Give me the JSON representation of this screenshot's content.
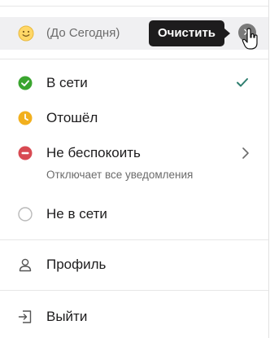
{
  "status": {
    "text": "(До Сегодня)",
    "clear_tooltip": "Очистить"
  },
  "presence": {
    "items": [
      {
        "label": "В сети",
        "state": "online",
        "color": "#3aa52f",
        "selected": true
      },
      {
        "label": "Отошёл",
        "state": "away",
        "color": "#f2b01e"
      },
      {
        "label": "Не беспокоить",
        "state": "dnd",
        "color": "#d84a52",
        "sub": "Отключает все уведомления"
      },
      {
        "label": "Не в сети",
        "state": "offline",
        "color": "#ffffff"
      }
    ]
  },
  "menu": {
    "profile": "Профиль",
    "logout": "Выйти"
  },
  "colors": {
    "accent_check": "#2d7d6e"
  },
  "icons": [
    "smiley-emoji-icon",
    "clear-x-icon",
    "checkmark-icon",
    "chevron-right-icon",
    "user-icon",
    "logout-icon"
  ]
}
